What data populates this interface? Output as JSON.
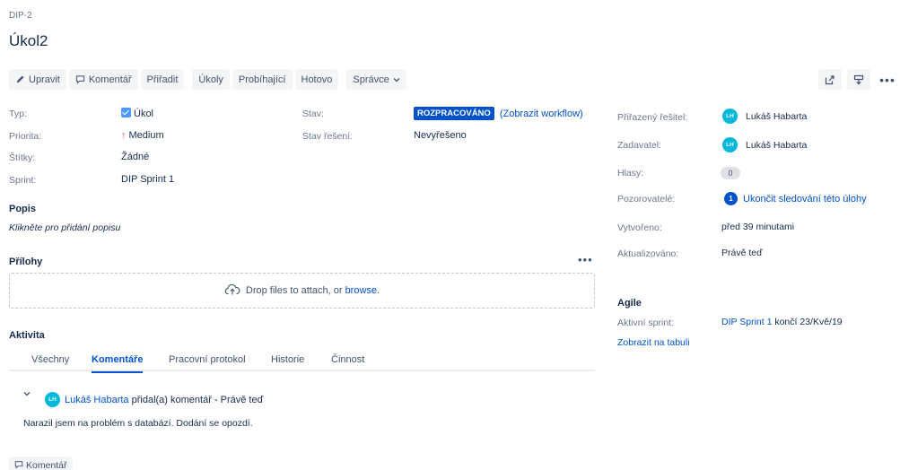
{
  "issue": {
    "key": "DIP-2",
    "title": "Úkol2"
  },
  "toolbar": {
    "edit": "Upravit",
    "comment": "Komentář",
    "assign": "Přiřadit",
    "tasks": "Úkoly",
    "in_progress": "Probíhající",
    "done": "Hotovo",
    "admin": "Správce"
  },
  "details": {
    "type_label": "Typ:",
    "type_value": "Úkol",
    "priority_label": "Priorita:",
    "priority_value": "Medium",
    "labels_label": "Štítky:",
    "labels_value": "Žádné",
    "sprint_label": "Sprint:",
    "sprint_value": "DIP Sprint 1",
    "status_label": "Stav:",
    "status_value": "ROZPRACOVÁNO",
    "workflow_link": "(Zobrazit workflow)",
    "resolution_label": "Stav řešení:",
    "resolution_value": "Nevyřešeno"
  },
  "description": {
    "heading": "Popis",
    "placeholder": "Klikněte pro přidání popisu"
  },
  "attachments": {
    "heading": "Přílohy",
    "drop_text": "Drop files to attach, or ",
    "browse": "browse."
  },
  "activity": {
    "heading": "Aktivita",
    "tabs": [
      "Všechny",
      "Komentáře",
      "Pracovní protokol",
      "Historie",
      "Činnost"
    ],
    "active_tab": "Komentáře"
  },
  "comment": {
    "avatar": "LH",
    "author": "Lukáš Habarta",
    "action": " přidal(a) komentář - ",
    "time": "Právě teď",
    "body": "Narazil jsem na problém s databází. Dodání se opozdí."
  },
  "add_comment": "Komentář",
  "people": {
    "assignee_label": "Přiřazený řešitel:",
    "assignee": "Lukáš Habarta",
    "reporter_label": "Zadavatel:",
    "reporter": "Lukáš Habarta",
    "votes_label": "Hlasy:",
    "votes": "0",
    "watchers_label": "Pozorovatelé:",
    "watchers": "1",
    "watch_link": "Ukončit sledování této úlohy",
    "avatar": "LH"
  },
  "dates": {
    "created_label": "Vytvořeno:",
    "created": "před 39 minutami",
    "updated_label": "Aktualizováno:",
    "updated": "Právě teď"
  },
  "agile": {
    "heading": "Agile",
    "active_sprint_label": "Aktivní sprint:",
    "sprint_link": "DIP Sprint 1",
    "sprint_end": " končí 23/Kvě/19",
    "board_link": "Zobrazit na tabuli"
  },
  "colors": {
    "accent": "#0052cc",
    "avatar": "#00b8d9",
    "priority": "#ff5630"
  }
}
